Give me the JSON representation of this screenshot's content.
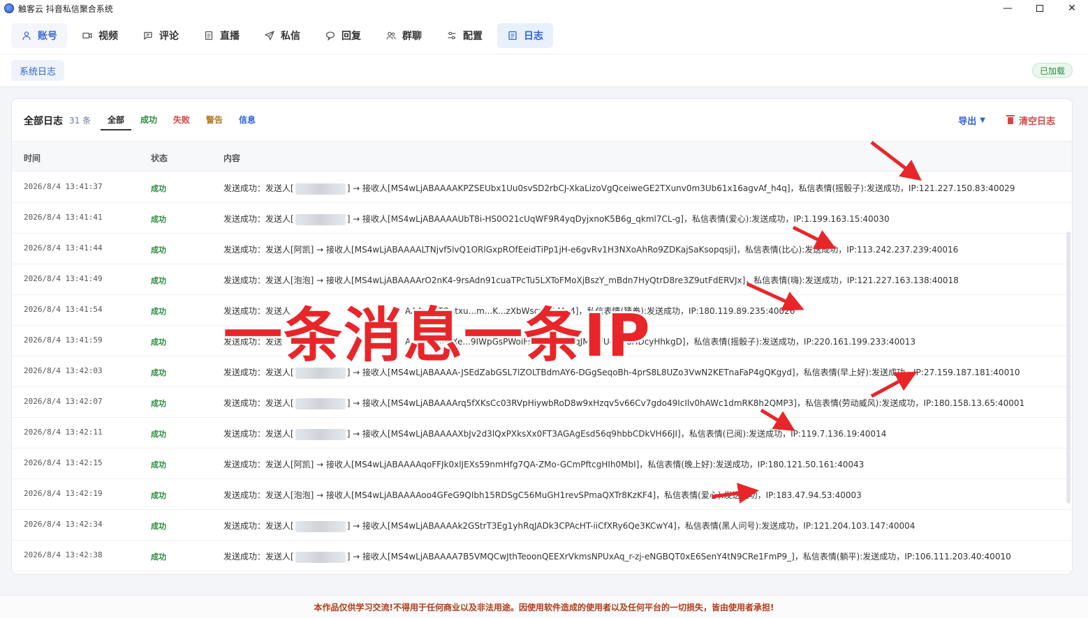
{
  "window": {
    "title": "触客云 抖音私信聚合系统"
  },
  "nav": {
    "tabs": [
      {
        "label": "账号",
        "icon": "user-icon"
      },
      {
        "label": "视频",
        "icon": "video-icon"
      },
      {
        "label": "评论",
        "icon": "comment-icon"
      },
      {
        "label": "直播",
        "icon": "live-icon"
      },
      {
        "label": "私信",
        "icon": "send-icon"
      },
      {
        "label": "回复",
        "icon": "reply-icon"
      },
      {
        "label": "群聊",
        "icon": "group-icon"
      },
      {
        "label": "配置",
        "icon": "settings-icon"
      },
      {
        "label": "日志",
        "icon": "log-icon"
      }
    ],
    "active": "日志"
  },
  "subbar": {
    "tab": "系统日志",
    "badge": "已加载"
  },
  "log": {
    "title": "全部日志",
    "count": "31 条",
    "filters": {
      "all": "全部",
      "success": "成功",
      "fail": "失败",
      "warn": "警告",
      "info": "信息"
    },
    "export_label": "导出",
    "clear_label": "清空日志",
    "columns": {
      "time": "时间",
      "status": "状态",
      "content": "内容"
    },
    "rows": [
      {
        "time": "2026/8/4 13:41:37",
        "status": "成功",
        "pre": "发送成功：发送人[",
        "post": "] → 接收人[MS4wLjABAAAAKPZSEUbx1Uu0svSD2rbCJ-XkaLizoVgQceiweGE2TXunv0m3Ub61x16agvAf_h4q]，私信表情(摇骰子):发送成功，IP:121.227.150.83:40029"
      },
      {
        "time": "2026/8/4 13:41:41",
        "status": "成功",
        "pre": "发送成功：发送人[",
        "post": "] → 接收人[MS4wLjABAAAAUbT8i-HS0O21cUqWF9R4yqDyjxnoK5B6g_qkml7CL-g]，私信表情(爱心):发送成功，IP:1.199.163.15:40030"
      },
      {
        "time": "2026/8/4 13:41:44",
        "status": "成功",
        "pre": "发送成功：发送人[阿凯] → 接收人[MS4wLjABAAAALTNjvf5lvQ1ORlGxpROfEeidTiPp1jH-e6gvRv1H3NXoAhRo9ZDKajSaKsopqsji]，私信表情(比心):发送成功，IP:113.242.237.239:40016",
        "post": ""
      },
      {
        "time": "2026/8/4 13:41:49",
        "status": "成功",
        "pre": "发送成功：发送人[泡泡] → 接收人[MS4wLjABAAAArO2nK4-9rsAdn91cuaTPcTu5LXToFMoXjBszY_mBdn7HyQtrD8re3Z9utFdERVJx]，私信表情(嗨):发送成功，IP:121.227.163.138:40018",
        "post": ""
      },
      {
        "time": "2026/8/4 13:41:54",
        "status": "成功",
        "pre": "发送成功：发送人",
        "post": "AAAzSSTOqtxu...m...K...zXbWsczzTkMn4]，私信表情(猜拳):发送成功，IP:180.119.89.235:40026"
      },
      {
        "time": "2026/8/4 13:41:59",
        "status": "成功",
        "pre": "发送成功：发送",
        "post": "AAAXWMmXe...9IWpGsPWoiFs4w1sEwp-qJMNJFUcVDuHDcyHhkgD]，私信表情(摇骰子):发送成功，IP:220.161.199.233:40013"
      },
      {
        "time": "2026/8/4 13:42:03",
        "status": "成功",
        "pre": "发送成功：发送人[",
        "post": "] → 接收人[MS4wLjABAAAA-JSEdZabGSL7lZOLTBdmAY6-DGgSeqoBh-4prS8L8UZo3VwN2KETnaFaP4gQKgyd]，私信表情(早上好):发送成功，IP:27.159.187.181:40010"
      },
      {
        "time": "2026/8/4 13:42:07",
        "status": "成功",
        "pre": "发送成功：发送人[",
        "post": "] → 接收人[MS4wLjABAAAArq5fXKsCc03RVpHiywbRoD8w9xHzqv5v66Cv7gdo49IcIlv0hAWc1dmRK8h2QMP3]，私信表情(劳动威风):发送成功，IP:180.158.13.65:40001"
      },
      {
        "time": "2026/8/4 13:42:11",
        "status": "成功",
        "pre": "发送成功：发送人[",
        "post": "] → 接收人[MS4wLjABAAAAXbJv2d3lQxPXksXx0FT3AGAgEsd56q9hbbCDkVH66JI]，私信表情(已阅):发送成功，IP:119.7.136.19:40014"
      },
      {
        "time": "2026/8/4 13:42:15",
        "status": "成功",
        "pre": "发送成功：发送人[阿凯] → 接收人[MS4wLjABAAAAqoFFJk0xlJEXs59nmHfg7QA-ZMo-GCmPftcgHIh0MbI]，私信表情(晚上好):发送成功，IP:180.121.50.161:40043",
        "post": ""
      },
      {
        "time": "2026/8/4 13:42:19",
        "status": "成功",
        "pre": "发送成功：发送人[泡泡] → 接收人[MS4wLjABAAAAoo4GFeG9QIbh15RDSgC56MuGH1revSPmaQXTr8KzKF4]，私信表情(爱心):发送成功，IP:183.47.94.53:40003",
        "post": ""
      },
      {
        "time": "2026/8/4 13:42:34",
        "status": "成功",
        "pre": "发送成功：发送人[",
        "post": "] → 接收人[MS4wLjABAAAAk2GStrT3Eg1yhRqJADk3CPAcHT-iiCfXRy6Qe3KCwY4]，私信表情(黑人问号):发送成功，IP:121.204.103.147:40004"
      },
      {
        "time": "2026/8/4 13:42:38",
        "status": "成功",
        "pre": "发送成功：发送人[",
        "post": "] → 接收人[MS4wLjABAAAA7B5VMQCwJthTeoonQEEXrVkmsNPUxAq_r-zj-eNGBQT0xE6SenY4tN9CRe1FmP9_]，私信表情(躺平):发送成功，IP:106.111.203.40:40010"
      }
    ]
  },
  "overlay": {
    "caption": "一条消息一条IP"
  },
  "footer": {
    "notice": "本作品仅供学习交流!不得用于任何商业以及非法用途。因使用软件造成的使用者以及任何平台的一切损失，皆由使用者承担!"
  },
  "colors": {
    "accent": "#2f63d6",
    "success": "#2b8a3e",
    "danger": "#d64545",
    "arrow": "#e8262a"
  }
}
